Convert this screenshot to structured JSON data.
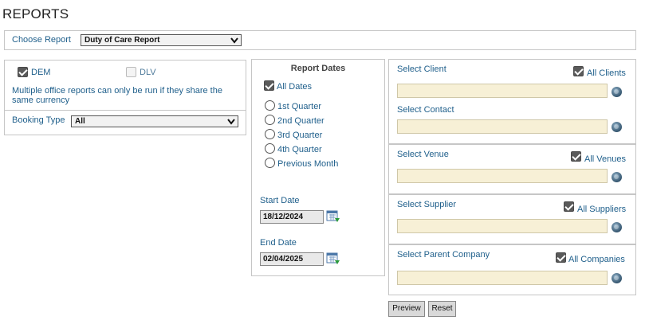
{
  "page_title": "REPORTS",
  "choose_report": {
    "label": "Choose Report",
    "selected": "Duty of Care Report"
  },
  "offices": {
    "dem_label": "DEM",
    "dem_checked": true,
    "dlv_label": "DLV",
    "dlv_checked": false,
    "note": "Multiple office reports can only be run if they share the same currency"
  },
  "booking_type": {
    "label": "Booking Type",
    "selected": "All"
  },
  "report_dates": {
    "title": "Report Dates",
    "all_dates_label": "All Dates",
    "all_dates_checked": true,
    "options": [
      "1st Quarter",
      "2nd Quarter",
      "3rd Quarter",
      "4th Quarter",
      "Previous Month"
    ],
    "start_label": "Start Date",
    "start_value": "18/12/2024",
    "end_label": "End Date",
    "end_value": "02/04/2025"
  },
  "filters": {
    "client_label": "Select Client",
    "all_clients_label": "All Clients",
    "contact_label": "Select Contact",
    "venue_label": "Select Venue",
    "all_venues_label": "All Venues",
    "supplier_label": "Select Supplier",
    "all_suppliers_label": "All Suppliers",
    "parent_label": "Select Parent Company",
    "all_companies_label": "All Companies"
  },
  "buttons": {
    "preview": "Preview",
    "reset": "Reset"
  },
  "icons": {
    "dropdown": "chevron-down-icon",
    "lookup": "globe-icon",
    "calendar": "calendar-icon"
  }
}
